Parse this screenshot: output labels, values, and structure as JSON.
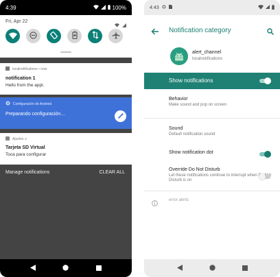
{
  "left": {
    "status_bar": {
      "time": "4:39",
      "battery": "100%"
    },
    "shade": {
      "date": "Fri, Apr 22",
      "tiles": [
        {
          "icon": "wifi-icon",
          "state": "on"
        },
        {
          "icon": "do-not-disturb-icon",
          "state": "off"
        },
        {
          "icon": "auto-rotate-icon",
          "state": "on"
        },
        {
          "icon": "battery-saver-icon",
          "state": "off"
        },
        {
          "icon": "mobile-data-icon",
          "state": "on"
        },
        {
          "icon": "airplane-mode-icon",
          "state": "off"
        }
      ]
    },
    "notifications": [
      {
        "header": "localnotifications • now",
        "title": "notification 1",
        "text": "Hello from the appl."
      },
      {
        "header": "Configuración de Android",
        "title": "Preparando configuración…"
      },
      {
        "header": "Ajustes ∨",
        "title": "Tarjeta SD Virtual",
        "text": "Toca para configurar"
      }
    ],
    "footer": {
      "manage": "Manage notifications",
      "clear": "CLEAR ALL"
    }
  },
  "right": {
    "status_bar": {
      "time": "4:43"
    },
    "app_bar": {
      "title": "Notification category"
    },
    "app": {
      "name": "alert_channel",
      "package": "localnotifications"
    },
    "show_notifications": {
      "label": "Show notifications",
      "enabled": true
    },
    "prefs": {
      "behavior": {
        "title": "Behavior",
        "subtitle": "Make sound and pop on screen"
      },
      "sound": {
        "title": "Sound",
        "subtitle": "Default notification sound"
      },
      "dot": {
        "title": "Show notification dot",
        "enabled": true
      },
      "dnd": {
        "title": "Override Do Not Disturb",
        "subtitle": "Let these notifications continue to interrupt when Do Not Disturb is on",
        "enabled": false
      }
    },
    "footer_info": "error alerts"
  },
  "colors": {
    "accent": "#1e8174",
    "notif_blue": "#3f72d9",
    "dark_bg": "#444444"
  }
}
